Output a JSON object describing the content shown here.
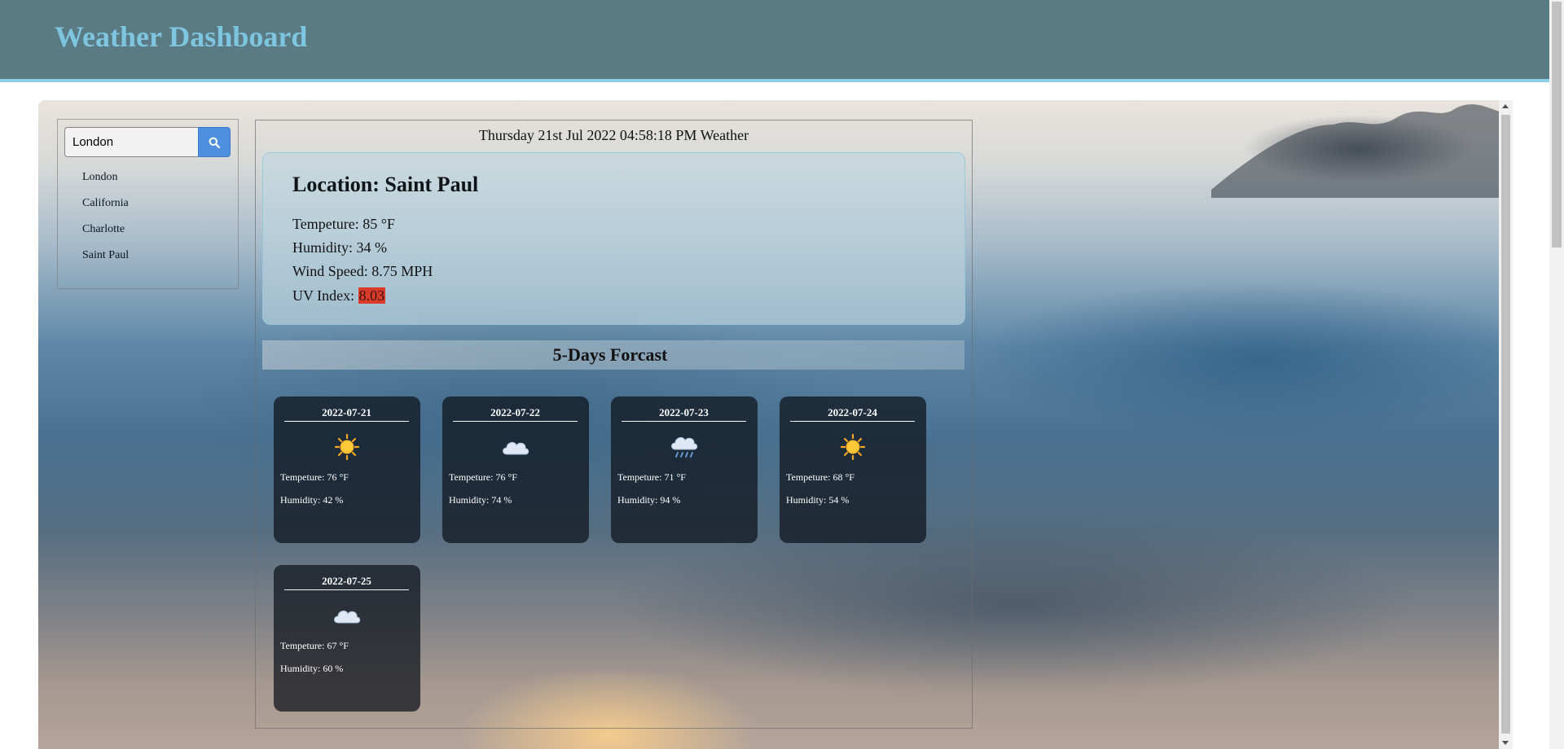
{
  "header": {
    "title": "Weather Dashboard"
  },
  "search": {
    "value": "London",
    "button_icon": "search-icon"
  },
  "history": [
    {
      "label": "London"
    },
    {
      "label": "California"
    },
    {
      "label": "Charlotte"
    },
    {
      "label": "Saint Paul"
    }
  ],
  "current": {
    "datetime": "Thursday 21st Jul 2022 04:58:18 PM Weather",
    "location": "Location: Saint Paul",
    "temperature": "Tempeture: 85 °F",
    "humidity": "Humidity: 34 %",
    "wind": "Wind Speed: 8.75 MPH",
    "uv_label": "UV Index: ",
    "uv_value": "8.03",
    "uv_color": "#d93a2a"
  },
  "forecast": {
    "title": "5-Days Forcast",
    "days": [
      {
        "date": "2022-07-21",
        "icon": "sun-icon",
        "temperature": "Tempeture: 76 °F",
        "humidity": "Humidity: 42 %"
      },
      {
        "date": "2022-07-22",
        "icon": "cloud-icon",
        "temperature": "Tempeture: 76 °F",
        "humidity": "Humidity: 74 %"
      },
      {
        "date": "2022-07-23",
        "icon": "rain-cloud-icon",
        "temperature": "Tempeture: 71 °F",
        "humidity": "Humidity: 94 %"
      },
      {
        "date": "2022-07-24",
        "icon": "sun-icon",
        "temperature": "Tempeture: 68 °F",
        "humidity": "Humidity: 54 %"
      },
      {
        "date": "2022-07-25",
        "icon": "cloud-icon",
        "temperature": "Tempeture: 67 °F",
        "humidity": "Humidity: 60 %"
      }
    ]
  },
  "colors": {
    "header_bg": "#5a7a84",
    "title": "#7ec5e0",
    "search_button": "#4f8fe0"
  }
}
